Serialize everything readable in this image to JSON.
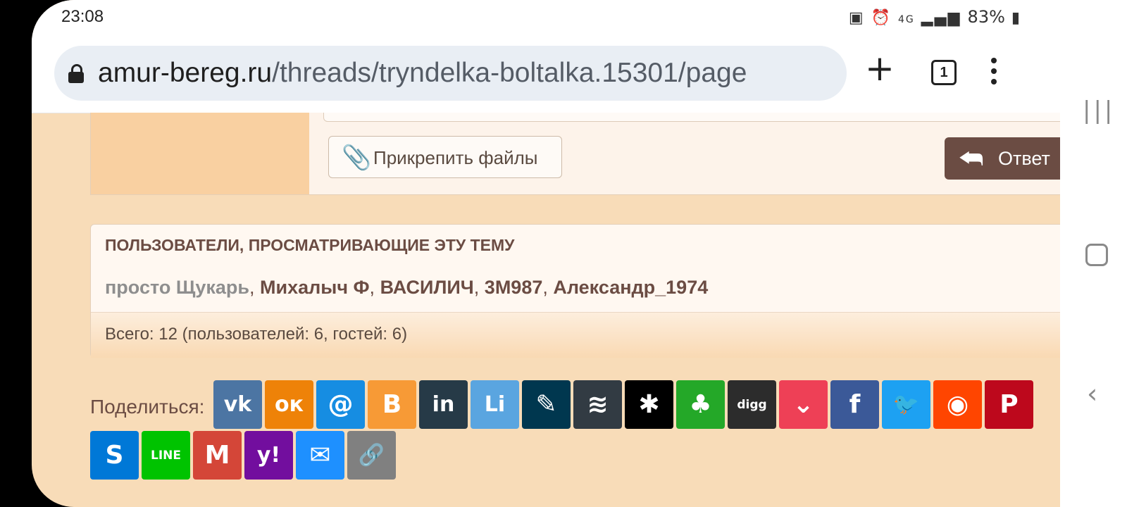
{
  "status_bar": {
    "time": "23:08",
    "network": "4G",
    "battery": "83%"
  },
  "browser": {
    "domain": "amur-bereg.ru",
    "path": "/threads/tryndelka-boltalka.15301/page",
    "tab_count": "1"
  },
  "reply_form": {
    "attach_label": "Прикрепить файлы",
    "reply_label": "Ответ"
  },
  "viewers": {
    "heading": "ПОЛЬЗОВАТЕЛИ, ПРОСМАТРИВАЮЩИЕ ЭТУ ТЕМУ",
    "users": [
      "просто Щукарь",
      "Михалыч Ф",
      "ВАСИЛИЧ",
      "3М987",
      "Александр_1974"
    ],
    "separator": ", ",
    "total": "Всего: 12 (пользователей: 6, гостей: 6)"
  },
  "share": {
    "label": "Поделиться:",
    "buttons": [
      {
        "name": "vk",
        "glyph": "vk",
        "color": "#4c75a3"
      },
      {
        "name": "odnoklassniki",
        "glyph": "ок",
        "color": "#ee8208"
      },
      {
        "name": "mail-ru",
        "glyph": "@",
        "color": "#168de2"
      },
      {
        "name": "blogger",
        "glyph": "B",
        "color": "#f79a36"
      },
      {
        "name": "linkedin",
        "glyph": "in",
        "color": "#263a47"
      },
      {
        "name": "livejournal",
        "glyph": "Li",
        "color": "#5aa5e0"
      },
      {
        "name": "livejournal-pen",
        "glyph": "✎",
        "color": "#00374f"
      },
      {
        "name": "buffer",
        "glyph": "≋",
        "color": "#323b43"
      },
      {
        "name": "asterisk",
        "glyph": "✱",
        "color": "#000000"
      },
      {
        "name": "evernote",
        "glyph": "♣",
        "color": "#24a828"
      },
      {
        "name": "digg",
        "glyph": "digg",
        "color": "#2c2c2c"
      },
      {
        "name": "pocket",
        "glyph": "⌄",
        "color": "#ee4056"
      },
      {
        "name": "facebook",
        "glyph": "f",
        "color": "#3b5998"
      },
      {
        "name": "twitter",
        "glyph": "🐦",
        "color": "#1da1f2"
      },
      {
        "name": "reddit",
        "glyph": "◉",
        "color": "#ff4500"
      },
      {
        "name": "pinterest",
        "glyph": "P",
        "color": "#bd081c"
      },
      {
        "name": "skype",
        "glyph": "S",
        "color": "#0078d7"
      },
      {
        "name": "line",
        "glyph": "LINE",
        "color": "#00c300"
      },
      {
        "name": "gmail",
        "glyph": "M",
        "color": "#d44638"
      },
      {
        "name": "yahoo",
        "glyph": "y!",
        "color": "#720e9e"
      },
      {
        "name": "email",
        "glyph": "✉",
        "color": "#1e90ff"
      },
      {
        "name": "copy-link",
        "glyph": "🔗",
        "color": "#808080"
      }
    ]
  }
}
